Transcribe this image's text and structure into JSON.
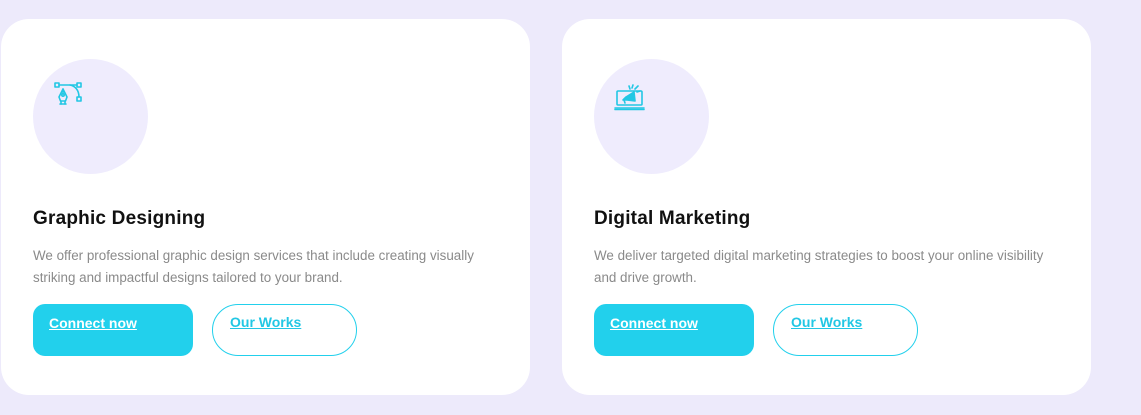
{
  "colors": {
    "background": "#edeafb",
    "card": "#ffffff",
    "icon_circle": "#efecfd",
    "accent": "#22d0ec",
    "title": "#111111",
    "description": "#8a8a8a"
  },
  "cards": [
    {
      "icon": "pen-tool-bezier-icon",
      "title": "Graphic Designing",
      "description": "We offer professional graphic design services that include creating visually striking and impactful designs tailored to your brand.",
      "primary_button": "Connect now",
      "secondary_button": "Our Works"
    },
    {
      "icon": "laptop-megaphone-icon",
      "title": "Digital Marketing",
      "description": "We deliver targeted digital marketing strategies to boost your online visibility and drive growth.",
      "primary_button": "Connect now",
      "secondary_button": "Our Works"
    }
  ]
}
